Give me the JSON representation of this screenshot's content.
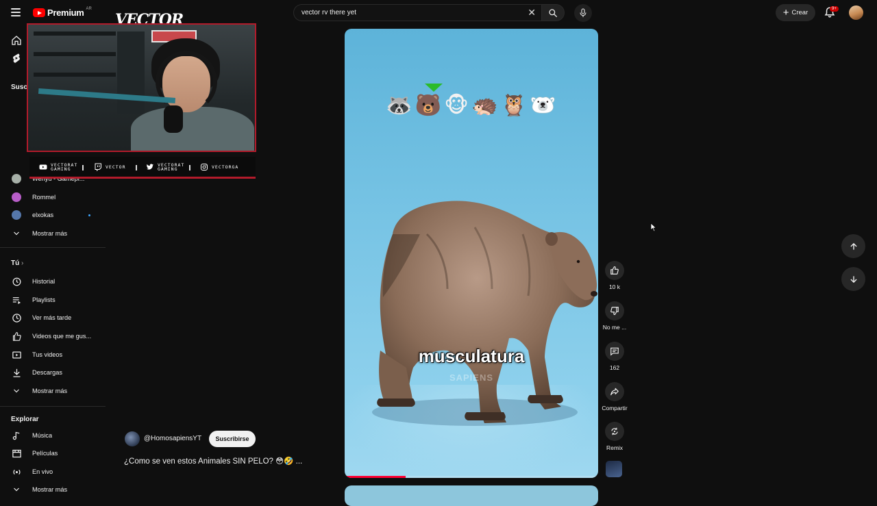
{
  "header": {
    "logo_word": "Premium",
    "logo_country": "AR",
    "search_query": "vector rv there yet",
    "create_label": "Crear",
    "notifications_badge": "9+"
  },
  "overlay": {
    "brand": "VECTOR",
    "social": [
      {
        "icon": "youtube-icon",
        "text": "VECTORAT\nGAMING"
      },
      {
        "icon": "twitch-icon",
        "text": "VECTOR"
      },
      {
        "icon": "twitter-icon",
        "text": "VECTORAT\nGAMING"
      },
      {
        "icon": "instagram-icon",
        "text": "VECTORGA"
      }
    ]
  },
  "sidebar": {
    "subs_label": "Susc",
    "channels": [
      {
        "label": "Wenyu - Gamepl...",
        "color": "#a7b0a8"
      },
      {
        "label": "Rommel",
        "color": "#b85ec8"
      },
      {
        "label": "elxokas",
        "color": "#5577aa"
      }
    ],
    "subs_more": "Mostrar más",
    "you_label": "Tú",
    "you_items": [
      {
        "icon": "history-icon",
        "label": "Historial"
      },
      {
        "icon": "playlists-icon",
        "label": "Playlists"
      },
      {
        "icon": "watch-later-icon",
        "label": "Ver más tarde"
      },
      {
        "icon": "liked-videos-icon",
        "label": "Videos que me gus..."
      },
      {
        "icon": "your-videos-icon",
        "label": "Tus videos"
      },
      {
        "icon": "downloads-icon",
        "label": "Descargas"
      },
      {
        "icon": "chevron-down-icon",
        "label": "Mostrar más"
      }
    ],
    "explore_label": "Explorar",
    "explore_items": [
      {
        "icon": "music-icon",
        "label": "Música"
      },
      {
        "icon": "movies-icon",
        "label": "Películas"
      },
      {
        "icon": "live-icon",
        "label": "En vivo"
      },
      {
        "icon": "chevron-down-icon",
        "label": "Mostrar más"
      }
    ]
  },
  "short": {
    "emojis": [
      "🦝",
      "🐻",
      "🐵",
      "🦔",
      "🦉",
      "🐻‍❄️"
    ],
    "caption": "musculatura",
    "watermark": "SAPIENS",
    "progress": 0.24,
    "channel_name": "@HomosapiensYT",
    "subscribe_label": "Suscribirse",
    "title": "¿Como se ven estos Animales SIN PELO? 😳🤣 ..."
  },
  "actions": [
    {
      "icon": "like-icon",
      "label": "10 k"
    },
    {
      "icon": "dislike-icon",
      "label": "No me ..."
    },
    {
      "icon": "comments-icon",
      "label": "162"
    },
    {
      "icon": "share-icon",
      "label": "Compartir"
    },
    {
      "icon": "remix-icon",
      "label": "Remix"
    }
  ],
  "colors": {
    "accent_red": "#ff0000",
    "frame_red": "#b31b2b",
    "background": "#0f0f0f"
  }
}
